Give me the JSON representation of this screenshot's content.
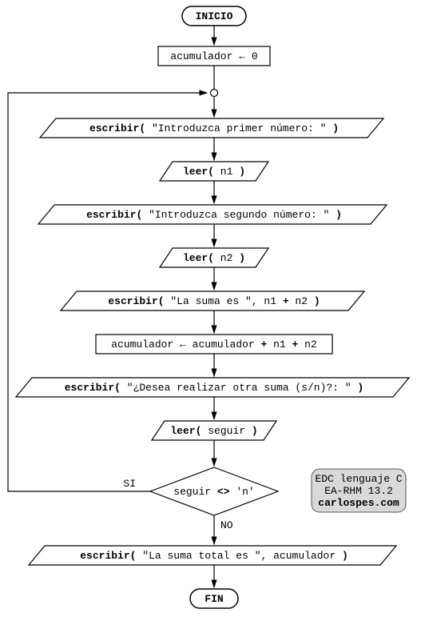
{
  "terminal": {
    "start": "INICIO",
    "end": "FIN"
  },
  "process": {
    "init": {
      "var": "acumulador",
      "arrow": "←",
      "val": "0"
    },
    "accum": {
      "lhs": "acumulador",
      "arrow": "←",
      "rhs1": "acumulador",
      "op1": "+",
      "rhs2": "n1",
      "op2": "+",
      "rhs3": "n2"
    }
  },
  "io": {
    "prompt1": {
      "fn": "escribir(",
      "arg": " \"Introduzca primer número: \" ",
      "close": ")"
    },
    "read1": {
      "fn": "leer(",
      "arg": " n1 ",
      "close": ")"
    },
    "prompt2": {
      "fn": "escribir(",
      "arg": " \"Introduzca segundo número: \" ",
      "close": ")"
    },
    "read2": {
      "fn": "leer(",
      "arg": " n2 ",
      "close": ")"
    },
    "sum": {
      "fn": "escribir(",
      "arg1": " \"La suma es \"",
      "comma": ",",
      "arg2": " n1 ",
      "op": "+",
      "arg3": " n2 ",
      "close": ")"
    },
    "again": {
      "fn": "escribir(",
      "arg": " \"¿Desea realizar otra suma (s/n)?: \" ",
      "close": ")"
    },
    "read3": {
      "fn": "leer(",
      "arg": " seguir ",
      "close": ")"
    },
    "total": {
      "fn": "escribir(",
      "arg1": " \"La suma total es \"",
      "comma": ",",
      "arg2": " acumulador ",
      "close": ")"
    }
  },
  "decision": {
    "var": "seguir",
    "op": "<>",
    "val": "'n'",
    "yes": "SI",
    "no": "NO"
  },
  "badge": {
    "line1": "EDC lenguaje C",
    "line2": "EA-RHM 13.2",
    "line3": "carlospes.com"
  }
}
